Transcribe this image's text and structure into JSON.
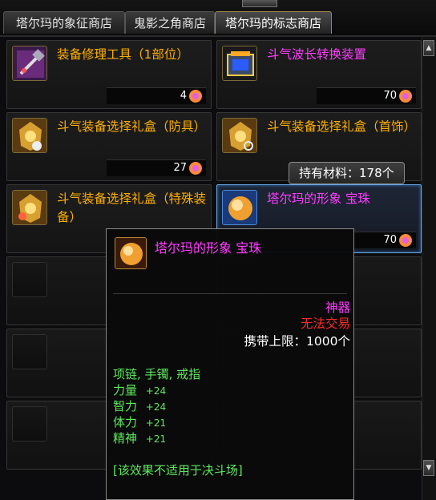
{
  "tabs": [
    {
      "label": "塔尔玛的象征商店",
      "active": false
    },
    {
      "label": "鬼影之角商店",
      "active": false
    },
    {
      "label": "塔尔玛的标志商店",
      "active": true
    }
  ],
  "items": [
    {
      "name": "装备修理工具（1部位）",
      "name_color": "#ffb000",
      "price": "4",
      "icon": "repair-hammer-icon"
    },
    {
      "name": "斗气波长转换装置",
      "name_color": "#ff3dff",
      "price": "70",
      "icon": "converter-device-icon"
    },
    {
      "name": "斗气装备选择礼盒（防具）",
      "name_color": "#ffb000",
      "price": "27",
      "icon": "armor-gift-box-icon"
    },
    {
      "name": "斗气装备选择礼盒（首饰）",
      "name_color": "#ffb000",
      "price": "",
      "icon": "accessory-gift-box-icon"
    },
    {
      "name": "斗气装备选择礼盒（特殊装备）",
      "name_color": "#ffb000",
      "price": "",
      "icon": "special-gift-box-icon"
    },
    {
      "name": "塔尔玛的形象  宝珠",
      "name_color": "#ff3dff",
      "price": "70",
      "icon": "orb-icon"
    }
  ],
  "material": {
    "label": "持有材料：178个"
  },
  "tooltip": {
    "title": "塔尔玛的形象  宝珠",
    "rarity": "神器",
    "trade": "无法交易",
    "carry_limit": "携带上限：1000个",
    "slots": "项链, 手镯, 戒指",
    "stats": [
      {
        "label": "力量",
        "value": "+24"
      },
      {
        "label": "智力",
        "value": "+24"
      },
      {
        "label": "体力",
        "value": "+21"
      },
      {
        "label": "精神",
        "value": "+21"
      }
    ],
    "note": "[该效果不适用于决斗场]"
  },
  "colors": {
    "epic": "#ff3dff",
    "rare_name": "#ffb000",
    "stat_green": "#5ee85e",
    "untradeable": "#ff2a2a",
    "selected_border": "#6aa7e6"
  }
}
